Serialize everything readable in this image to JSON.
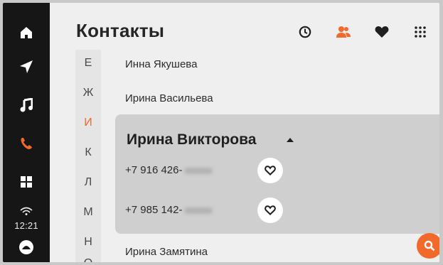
{
  "status": {
    "time": "12:21"
  },
  "header": {
    "title": "Контакты"
  },
  "alphabet": [
    "Е",
    "Ж",
    "И",
    "К",
    "Л",
    "М",
    "Н",
    "О"
  ],
  "alphabet_active": "И",
  "contacts_before": [
    "Инна Якушева",
    "Ирина Васильева"
  ],
  "expanded": {
    "name": "Ирина Викторова",
    "phones": [
      "+7 916 426-",
      "+7 985 142-"
    ]
  },
  "contacts_after": [
    "Ирина Замятина"
  ],
  "colors": {
    "accent": "#f26a2b",
    "rail": "#161616",
    "card": "#cfcfcf"
  },
  "icons": {
    "rail": [
      "home-icon",
      "navigation-icon",
      "music-icon",
      "phone-icon",
      "apps-grid-icon",
      "assistant-icon"
    ],
    "top": [
      "recent-clock-icon",
      "contacts-icon",
      "favorites-heart-icon",
      "keypad-icon"
    ]
  }
}
